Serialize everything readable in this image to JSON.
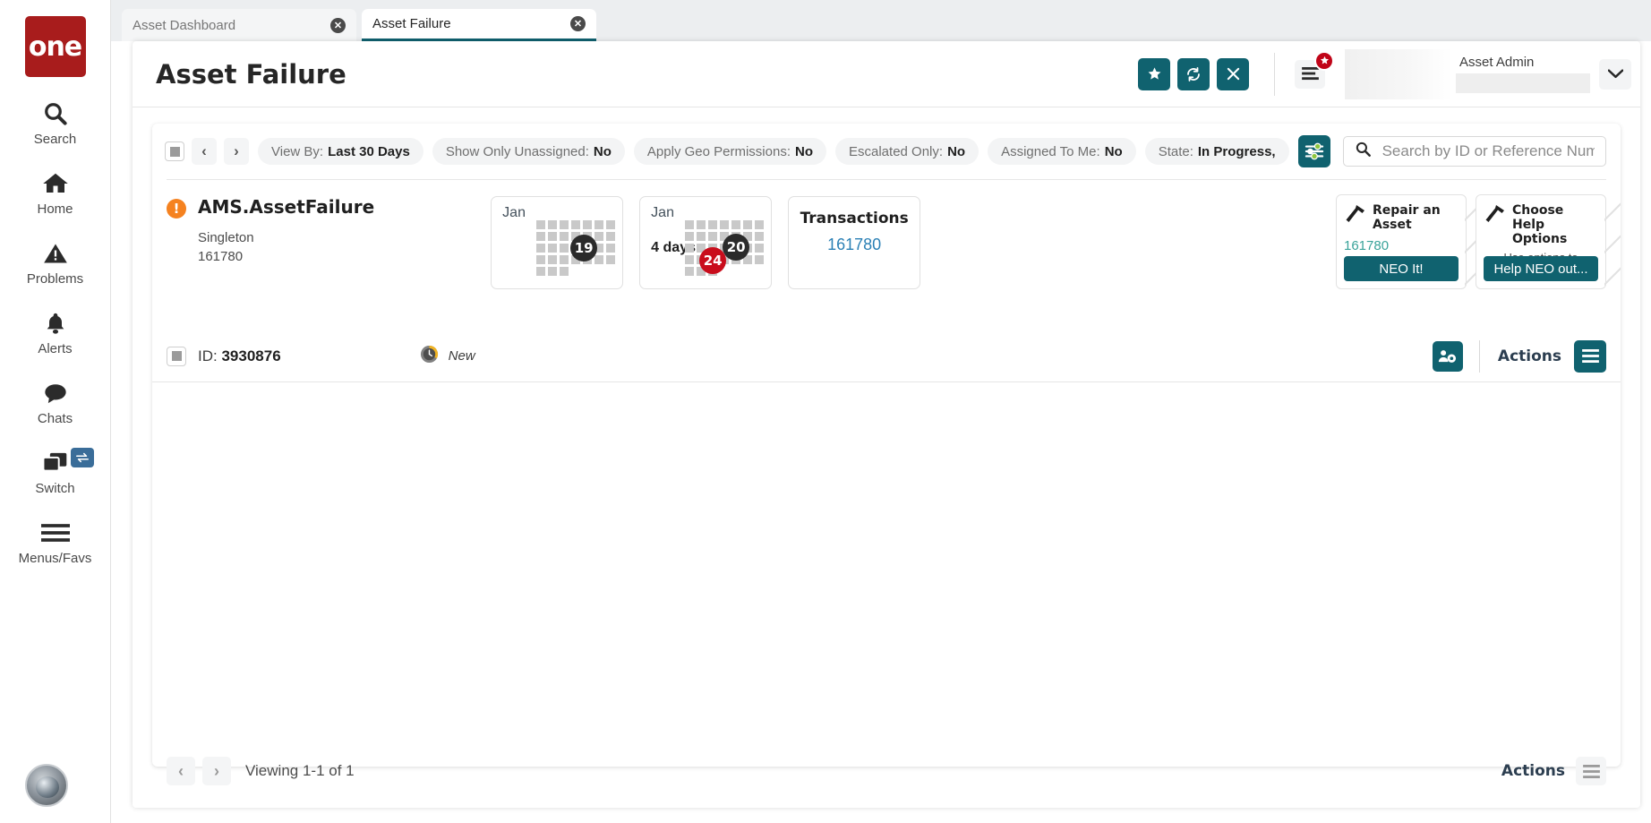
{
  "brand": {
    "logo_text": "one"
  },
  "sidebar": {
    "items": [
      {
        "label": "Search",
        "icon": "search-icon"
      },
      {
        "label": "Home",
        "icon": "home-icon"
      },
      {
        "label": "Problems",
        "icon": "warning-triangle-icon"
      },
      {
        "label": "Alerts",
        "icon": "bell-icon"
      },
      {
        "label": "Chats",
        "icon": "chat-bubble-icon"
      },
      {
        "label": "Switch",
        "icon": "windows-icon",
        "badge_icon": "swap-arrows-icon"
      },
      {
        "label": "Menus/Favs",
        "icon": "hamburger-icon"
      }
    ]
  },
  "tabs": [
    {
      "label": "Asset Dashboard",
      "active": false,
      "close_icon": "close-circle-icon"
    },
    {
      "label": "Asset Failure",
      "active": true,
      "close_icon": "close-circle-icon"
    }
  ],
  "header": {
    "title": "Asset Failure",
    "buttons": [
      {
        "name": "favorite-button",
        "icon": "star-icon"
      },
      {
        "name": "refresh-button",
        "icon": "refresh-icon"
      },
      {
        "name": "close-button",
        "icon": "x-icon"
      }
    ],
    "menu_icon": "hamburger-menu-icon",
    "menu_badge_icon": "star-icon",
    "user_name": "Asset Admin",
    "user_chevron_icon": "chevron-down-icon"
  },
  "filterbar": {
    "select_all_icon": "checkbox-icon",
    "prev_icon": "chevron-left-icon",
    "next_icon": "chevron-right-icon",
    "chips": [
      {
        "label": "View By:",
        "value": "Last 30 Days"
      },
      {
        "label": "Show Only Unassigned:",
        "value": "No"
      },
      {
        "label": "Apply Geo Permissions:",
        "value": "No"
      },
      {
        "label": "Escalated Only:",
        "value": "No"
      },
      {
        "label": "Assigned To Me:",
        "value": "No"
      },
      {
        "label": "State:",
        "value": "In Progress,"
      }
    ],
    "settings_icon": "sliders-icon",
    "search": {
      "icon": "search-icon",
      "placeholder": "Search by ID or Reference Number",
      "value": ""
    }
  },
  "result": {
    "status_icon": "exclamation-circle-icon",
    "title": "AMS.AssetFailure",
    "subtitle_line1": "Singleton",
    "subtitle_line2": "161780",
    "cards": [
      {
        "type": "calendar",
        "month": "Jan",
        "days_label": "",
        "badges": [
          {
            "value": "19",
            "color": "dark"
          }
        ]
      },
      {
        "type": "calendar",
        "month": "Jan",
        "days_label": "4 days",
        "badges": [
          {
            "value": "24",
            "color": "red"
          },
          {
            "value": "20",
            "color": "dark"
          }
        ]
      },
      {
        "type": "value",
        "title": "Transactions",
        "value": "161780"
      }
    ],
    "action_cards": [
      {
        "icon": "hammer-icon",
        "title": "Repair an Asset",
        "link": "161780",
        "subtitle": "",
        "button_label": "NEO It!"
      },
      {
        "icon": "hammer-icon",
        "title": "Choose Help Options",
        "link": "",
        "subtitle": "Use options to resolve the issue",
        "button_label": "Help NEO out..."
      }
    ]
  },
  "id_row": {
    "checkbox_icon": "checkbox-icon",
    "id_label": "ID:",
    "id_value": "3930876",
    "state_icon": "clock-icon",
    "state_text": "New",
    "team_icon": "people-gear-icon",
    "actions_label": "Actions",
    "actions_icon": "hamburger-menu-icon"
  },
  "footer": {
    "prev_icon": "chevron-left-icon",
    "next_icon": "chevron-right-icon",
    "viewing_text": "Viewing 1-1 of 1",
    "actions_label": "Actions",
    "actions_icon": "hamburger-menu-icon"
  },
  "colors": {
    "teal": "#10626f",
    "red": "#c90d1c",
    "orange": "#f58220",
    "brand_red": "#a81c1c",
    "link_blue": "#2b80b5",
    "link_teal": "#3aa39a"
  }
}
